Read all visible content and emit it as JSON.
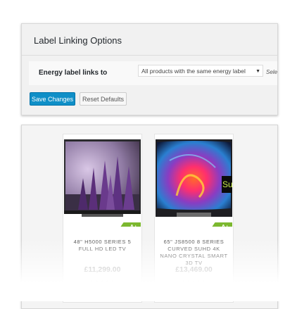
{
  "settings": {
    "title": "Label Linking Options",
    "row_label": "Energy label links to",
    "select_value": "All products with the same energy label",
    "select_trailing": "Sele",
    "save_label": "Save Changes",
    "reset_label": "Reset Defaults"
  },
  "products": [
    {
      "title": "48\" H5000 Series 5 Full HD LED TV",
      "price": "£11,299.00",
      "energy": "A+"
    },
    {
      "title": "65\" JS8500 8 Series Curved SUHD 4K Nano Crystal Smart 3D TV",
      "price": "£13,469.00",
      "energy": "A+"
    }
  ],
  "colors": {
    "accent": "#0f8fc7",
    "energy_badge": "#7cb82f"
  }
}
